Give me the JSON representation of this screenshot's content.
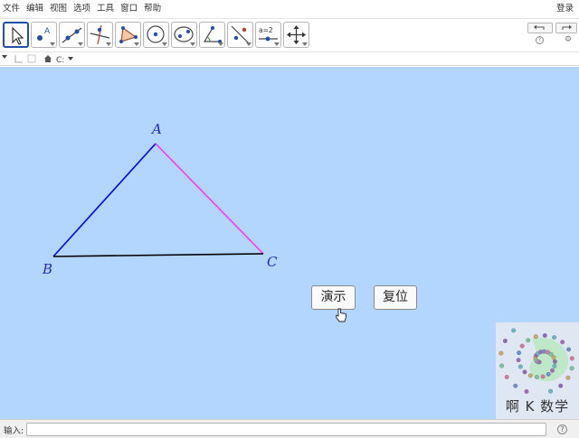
{
  "menu": [
    "文件",
    "编辑",
    "视图",
    "选项",
    "工具",
    "窗口",
    "帮助"
  ],
  "login": "登录",
  "tools": [
    {
      "name": "move-tool-icon",
      "active": true
    },
    {
      "name": "point-tool-icon"
    },
    {
      "name": "line-tool-icon"
    },
    {
      "name": "perpendicular-line-tool-icon"
    },
    {
      "name": "polygon-tool-icon"
    },
    {
      "name": "circle-center-point-tool-icon"
    },
    {
      "name": "circle-three-points-tool-icon"
    },
    {
      "name": "angle-tool-icon"
    },
    {
      "name": "reflect-tool-icon"
    },
    {
      "name": "slider-tool-icon",
      "text": "a=2"
    },
    {
      "name": "move-graphics-view-tool-icon"
    }
  ],
  "help_glyph": "?",
  "gear_glyph": "⚙",
  "points": {
    "a": "A",
    "b": "B",
    "c": "C"
  },
  "buttons": {
    "demo": "演示",
    "reset": "复位"
  },
  "logo_text": "啊 K 数学",
  "input": {
    "label": "输入:",
    "value": ""
  },
  "colors": {
    "canvas": "#b2d6ff",
    "segment_ab": "#0000ff",
    "segment_ac": "#ff33ff",
    "segment_bc": "#000000",
    "point_label": "#2828c8"
  }
}
